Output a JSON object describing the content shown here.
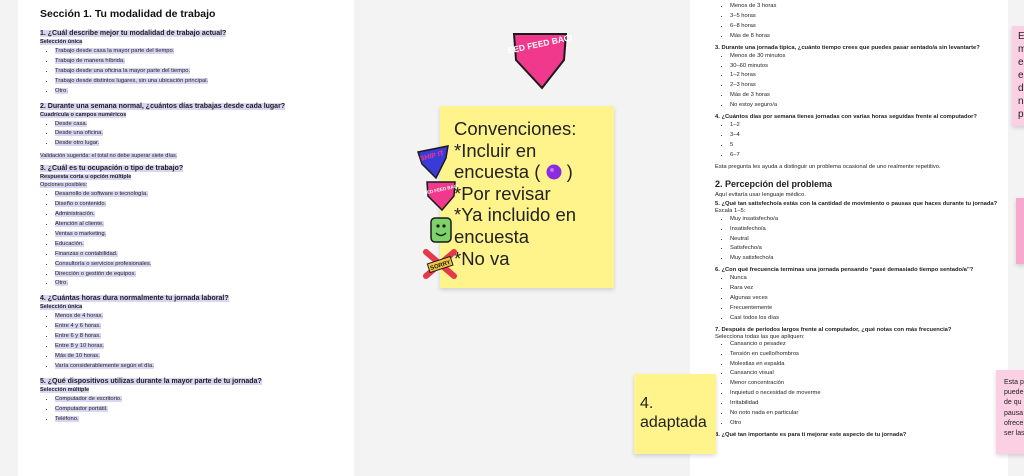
{
  "left_doc": {
    "section_title": "Sección 1. Tu modalidad de trabajo",
    "q1": {
      "title": "1. ¿Cuál describe mejor tu modalidad de trabajo actual?",
      "type": "Selección única",
      "options": [
        "Trabajo desde casa la mayor parte del tiempo.",
        "Trabajo de manera híbrida.",
        "Trabajo desde una oficina la mayor parte del tiempo.",
        "Trabajo desde distintos lugares, sin una ubicación principal.",
        "Otro."
      ]
    },
    "q2": {
      "title": "2. Durante una semana normal, ¿cuántos días trabajas desde cada lugar?",
      "type": "Cuadrícula o campos numéricos",
      "options": [
        "Desde casa.",
        "Desde una oficina.",
        "Desde otro lugar."
      ],
      "validation": "Validación sugerida: el total no debe superar siete días."
    },
    "q3": {
      "title": "3. ¿Cuál es tu ocupación o tipo de trabajo?",
      "type": "Respuesta corta u opción múltiple",
      "possible": "Opciones posibles:",
      "options": [
        "Desarrollo de software o tecnología.",
        "Diseño o contenido.",
        "Administración.",
        "Atención al cliente.",
        "Ventas o marketing.",
        "Educación.",
        "Finanzas o contabilidad.",
        "Consultoría o servicios profesionales.",
        "Dirección o gestión de equipos.",
        "Otro."
      ]
    },
    "q4": {
      "title": "4. ¿Cuántas horas dura normalmente tu jornada laboral?",
      "type": "Selección única",
      "options": [
        "Menos de 4 horas.",
        "Entre 4 y 6 horas.",
        "Entre 6 y 8 horas.",
        "Entre 8 y 10 horas.",
        "Más de 10 horas.",
        "Varía considerablemente según el día."
      ]
    },
    "q5": {
      "title": "5. ¿Qué dispositivos utilizas durante la mayor parte de tu jornada?",
      "type": "Selección múltiple",
      "options": [
        "Computador de escritorio.",
        "Computador portátil.",
        "Teléfono."
      ]
    }
  },
  "right_doc": {
    "top_options": [
      "Menos de 3 horas",
      "3–5 horas",
      "6–8 horas",
      "Más de 8 horas"
    ],
    "q3": {
      "title": "3. Durante una jornada típica, ¿cuánto tiempo crees que puedes pasar sentado/a sin levantarte?",
      "options": [
        "Menos de 30 minutos",
        "30–60 minutos",
        "1–2 horas",
        "2–3 horas",
        "Más de 3 horas",
        "No estoy seguro/a"
      ]
    },
    "q4": {
      "title": "4. ¿Cuántos días por semana tienes jornadas con varias horas seguidas frente al computador?",
      "options": [
        "1–2",
        "3–4",
        "5",
        "6–7"
      ],
      "note": "Esta pregunta les ayuda a distinguir un problema ocasional de uno realmente repetitivo."
    },
    "section2_title": "2. Percepción del problema",
    "section2_note": "Aquí evitaría usar lenguaje médico.",
    "q5": {
      "title": "5. ¿Qué tan satisfecho/a estás con la cantidad de movimiento o pausas que haces durante tu jornada?",
      "scale": "Escala 1–5:",
      "options": [
        "Muy insatisfecho/a",
        "Insatisfecho/a",
        "Neutral",
        "Satisfecho/a",
        "Muy satisfecho/a"
      ]
    },
    "q6": {
      "title": "6. ¿Con qué frecuencia terminas una jornada pensando “pasé demasiado tiempo sentado/a”?",
      "options": [
        "Nunca",
        "Rara vez",
        "Algunas veces",
        "Frecuentemente",
        "Casi todos los días"
      ]
    },
    "q7": {
      "title": "7. Después de periodos largos frente al computador, ¿qué notas con más frecuencia?",
      "subtitle": "Selecciona todas las que apliquen:",
      "options": [
        "Cansancio o pesadez",
        "Tensión en cuello/hombros",
        "Molestias en espalda",
        "Cansancio visual",
        "Menor concentración",
        "Inquietud o necesidad de moverme",
        "Irritabilidad",
        "No noto nada en particular",
        "Otro"
      ]
    },
    "q8": {
      "title": "8. ¿Qué tan importante es para ti mejorar este aspecto de tu jornada?"
    }
  },
  "sticky_main": {
    "lines": [
      "Convenciones:",
      "*Incluir en",
      "encuesta (",
      "*Por revisar",
      "*Ya incluido en",
      "encuesta",
      "*No va"
    ],
    "line3_suffix": ")"
  },
  "sticky_small": {
    "lines": [
      "4.",
      "adaptada"
    ]
  },
  "sticky_pink_top": {
    "chars": [
      "E",
      "m",
      "e",
      "e",
      "d",
      "n",
      "p"
    ]
  },
  "sticky_pink_bot": {
    "lines": [
      "Esta p",
      "puede",
      "de qu",
      "pausa",
      "ofrece",
      "ser las"
    ]
  },
  "stickers": {
    "need_feedback_big": "NEED FEED BACK",
    "ship_it": "SHIP IT",
    "need_feedback_small": "NEED FEED BACK",
    "sorry": "SORRY"
  },
  "colors": {
    "highlight": "#d8d6f2",
    "sticky_yellow": "#fff48c",
    "sticky_pink": "#fbd0e2",
    "sticker_pink": "#f0388c",
    "purple_dot": "#8a2be2"
  }
}
